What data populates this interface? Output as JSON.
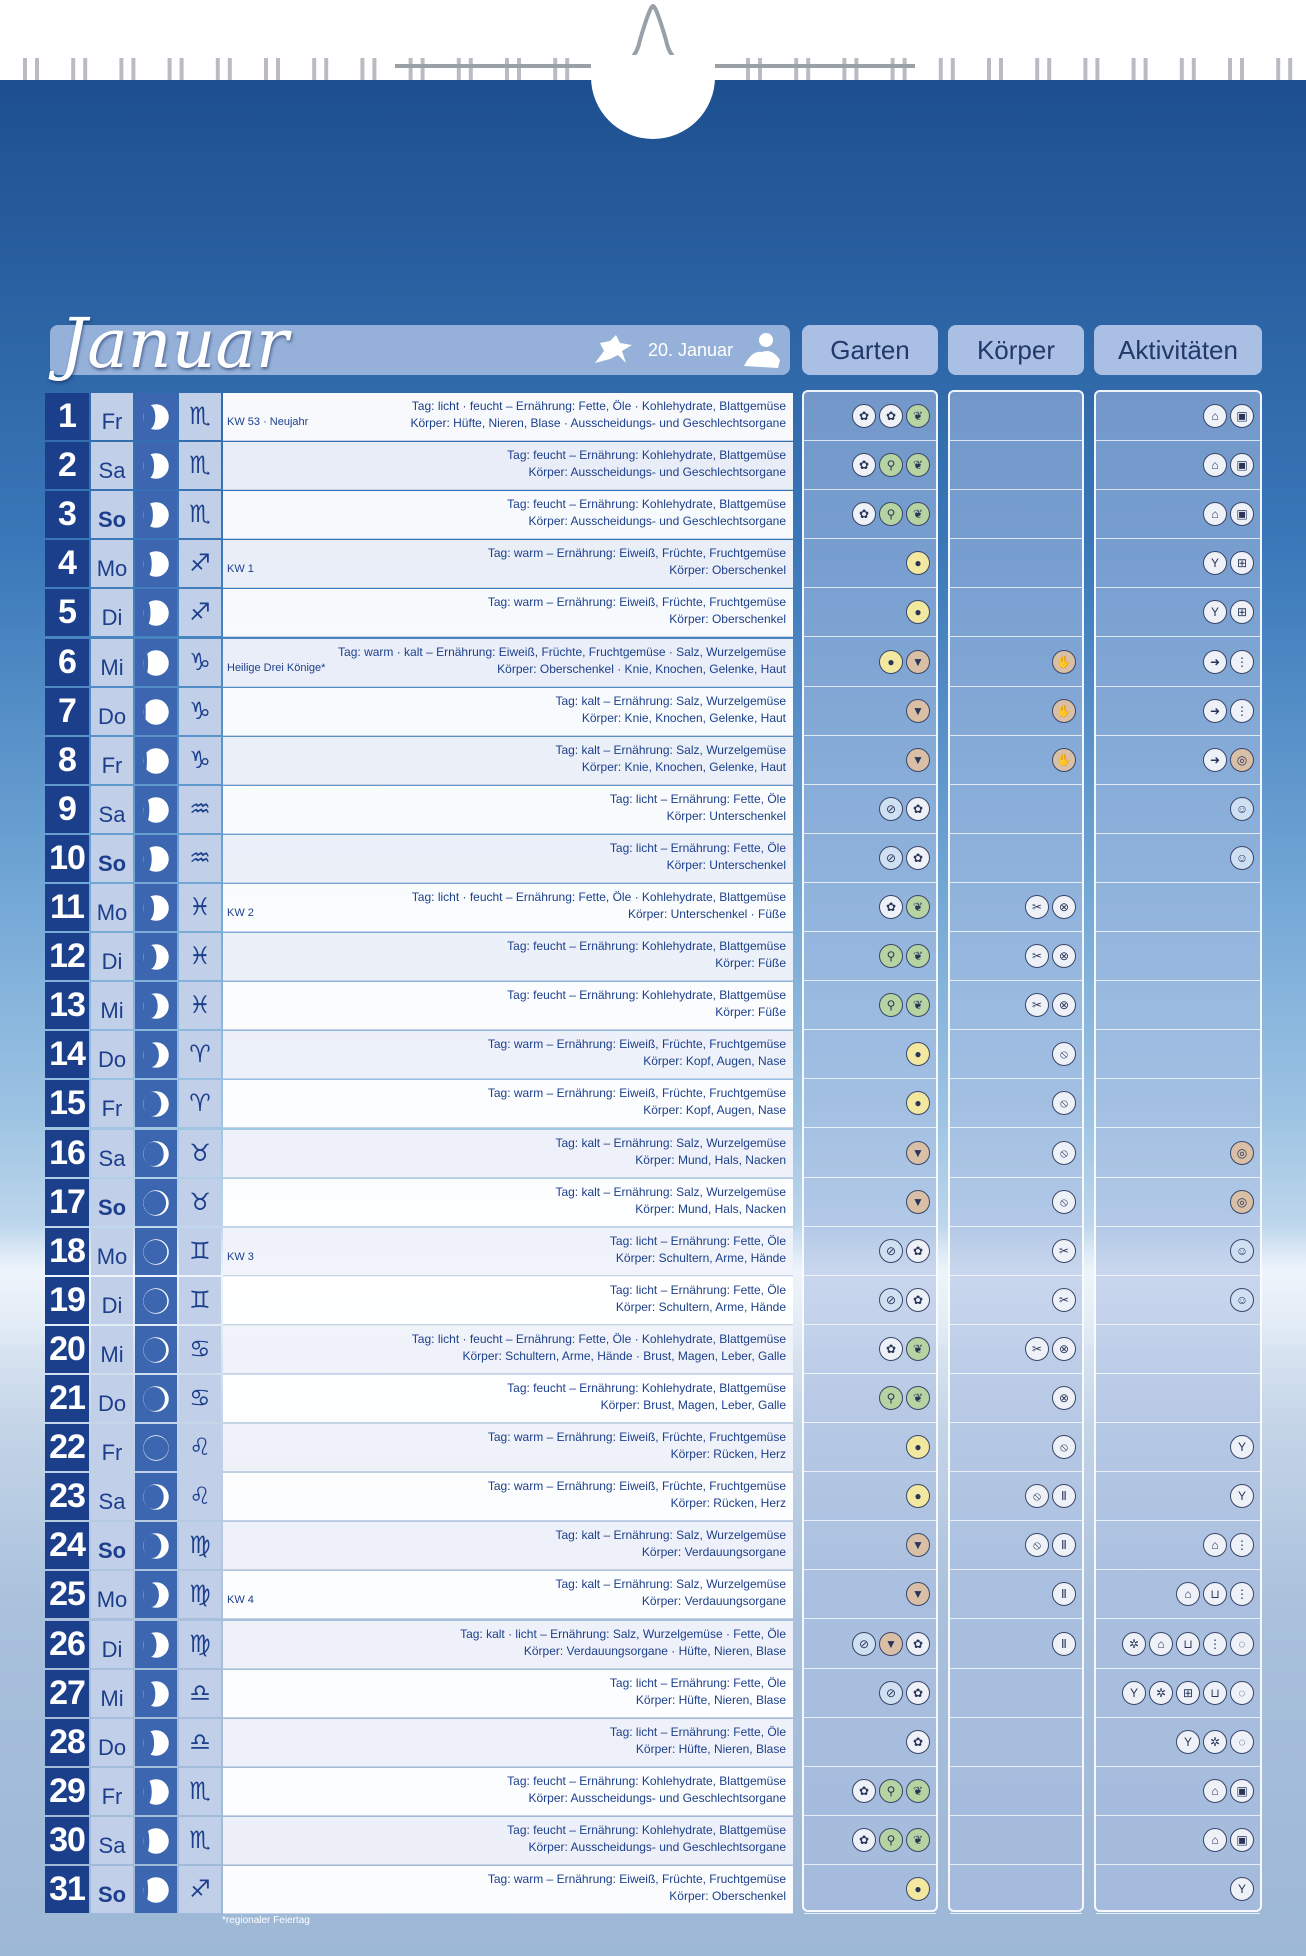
{
  "header": {
    "month": "Januar",
    "sign_change_label": "20. Januar",
    "categories": [
      "Garten",
      "Körper",
      "Aktivitäten"
    ]
  },
  "days": [
    {
      "num": "1",
      "wd": "Fr",
      "note": "KW 53 · Neujahr",
      "l1": "Tag: licht · feucht – Ernährung: Fette, Öle · Kohlehydrate, Blattgemüse",
      "l2": "Körper: Hüfte, Nieren, Blase · Ausscheidungs- und Geschlechtsorgane",
      "g": [
        "flower-icon",
        "flower-icon",
        "leaf-icon"
      ],
      "k": [],
      "a": [
        "cleaning-icon",
        "jar-icon"
      ]
    },
    {
      "num": "2",
      "wd": "Sa",
      "note": "",
      "l1": "Tag: feucht – Ernährung: Kohlehydrate, Blattgemüse",
      "l2": "Körper: Ausscheidungs- und Geschlechtsorgane",
      "g": [
        "flower-icon",
        "watering-icon",
        "leaf-icon"
      ],
      "k": [],
      "a": [
        "cleaning-icon",
        "jar-icon"
      ]
    },
    {
      "num": "3",
      "wd": "So",
      "note": "",
      "l1": "Tag: feucht – Ernährung: Kohlehydrate, Blattgemüse",
      "l2": "Körper: Ausscheidungs- und Geschlechtsorgane",
      "g": [
        "flower-icon",
        "watering-icon",
        "leaf-icon"
      ],
      "k": [],
      "a": [
        "cleaning-icon",
        "jar-icon"
      ]
    },
    {
      "num": "4",
      "wd": "Mo",
      "note": "KW 1",
      "l1": "Tag: warm – Ernährung: Eiweiß, Früchte, Fruchtgemüse",
      "l2": "Körper: Oberschenkel",
      "g": [
        "fruit-icon"
      ],
      "k": [],
      "a": [
        "glass-icon",
        "window-icon"
      ]
    },
    {
      "num": "5",
      "wd": "Di",
      "note": "",
      "l1": "Tag: warm – Ernährung: Eiweiß, Früchte, Fruchtgemüse",
      "l2": "Körper: Oberschenkel",
      "g": [
        "fruit-icon"
      ],
      "k": [],
      "a": [
        "glass-icon",
        "window-icon"
      ]
    },
    {
      "num": "6",
      "wd": "Mi",
      "note": "Heilige Drei Könige*",
      "l1": "Tag: warm · kalt – Ernährung: Eiweiß, Früchte, Fruchtgemüse · Salz, Wurzelgemüse",
      "l2": "Körper: Oberschenkel · Knie, Knochen, Gelenke, Haut",
      "g": [
        "fruit-icon",
        "root-icon"
      ],
      "k": [
        "hand-icon"
      ],
      "a": [
        "arrow-icon",
        "bottles-icon"
      ]
    },
    {
      "num": "7",
      "wd": "Do",
      "note": "",
      "l1": "Tag: kalt – Ernährung: Salz, Wurzelgemüse",
      "l2": "Körper: Knie, Knochen, Gelenke, Haut",
      "g": [
        "root-icon"
      ],
      "k": [
        "hand-icon"
      ],
      "a": [
        "arrow-icon",
        "bottles-icon"
      ]
    },
    {
      "num": "8",
      "wd": "Fr",
      "note": "",
      "l1": "Tag: kalt – Ernährung: Salz, Wurzelgemüse",
      "l2": "Körper: Knie, Knochen, Gelenke, Haut",
      "g": [
        "root-icon"
      ],
      "k": [
        "hand-icon"
      ],
      "a": [
        "arrow-icon",
        "coin-icon"
      ]
    },
    {
      "num": "9",
      "wd": "Sa",
      "note": "",
      "l1": "Tag: licht – Ernährung: Fette, Öle",
      "l2": "Körper: Unterschenkel",
      "g": [
        "no-spray-icon",
        "flower-icon"
      ],
      "k": [],
      "a": [
        "hair-icon"
      ]
    },
    {
      "num": "10",
      "wd": "So",
      "note": "",
      "l1": "Tag: licht – Ernährung: Fette, Öle",
      "l2": "Körper: Unterschenkel",
      "g": [
        "no-spray-icon",
        "flower-icon"
      ],
      "k": [],
      "a": [
        "hair-icon"
      ]
    },
    {
      "num": "11",
      "wd": "Mo",
      "note": "KW 2",
      "l1": "Tag: licht · feucht – Ernährung: Fette, Öle · Kohlehydrate, Blattgemüse",
      "l2": "Körper: Unterschenkel · Füße",
      "g": [
        "flower-icon",
        "leaf-icon"
      ],
      "k": [
        "no-cut-icon",
        "no-needle-icon"
      ],
      "a": []
    },
    {
      "num": "12",
      "wd": "Di",
      "note": "",
      "l1": "Tag: feucht – Ernährung: Kohlehydrate, Blattgemüse",
      "l2": "Körper: Füße",
      "g": [
        "watering-icon",
        "leaf-icon"
      ],
      "k": [
        "no-cut-icon",
        "no-needle-icon"
      ],
      "a": []
    },
    {
      "num": "13",
      "wd": "Mi",
      "note": "",
      "l1": "Tag: feucht – Ernährung: Kohlehydrate, Blattgemüse",
      "l2": "Körper: Füße",
      "g": [
        "watering-icon",
        "leaf-icon"
      ],
      "k": [
        "no-cut-icon",
        "no-needle-icon"
      ],
      "a": []
    },
    {
      "num": "14",
      "wd": "Do",
      "note": "",
      "l1": "Tag: warm – Ernährung: Eiweiß, Früchte, Fruchtgemüse",
      "l2": "Körper: Kopf, Augen, Nase",
      "g": [
        "fruit-icon"
      ],
      "k": [
        "no-treat-icon"
      ],
      "a": []
    },
    {
      "num": "15",
      "wd": "Fr",
      "note": "",
      "l1": "Tag: warm – Ernährung: Eiweiß, Früchte, Fruchtgemüse",
      "l2": "Körper: Kopf, Augen, Nase",
      "g": [
        "fruit-icon"
      ],
      "k": [
        "no-treat-icon"
      ],
      "a": []
    },
    {
      "num": "16",
      "wd": "Sa",
      "note": "",
      "l1": "Tag: kalt – Ernährung: Salz, Wurzelgemüse",
      "l2": "Körper: Mund, Hals, Nacken",
      "g": [
        "root-icon"
      ],
      "k": [
        "no-treat-icon"
      ],
      "a": [
        "coin-icon"
      ]
    },
    {
      "num": "17",
      "wd": "So",
      "note": "",
      "l1": "Tag: kalt – Ernährung: Salz, Wurzelgemüse",
      "l2": "Körper: Mund, Hals, Nacken",
      "g": [
        "root-icon"
      ],
      "k": [
        "no-treat-icon"
      ],
      "a": [
        "coin-icon"
      ]
    },
    {
      "num": "18",
      "wd": "Mo",
      "note": "KW 3",
      "l1": "Tag: licht – Ernährung: Fette, Öle",
      "l2": "Körper: Schultern, Arme, Hände",
      "g": [
        "no-spray-icon",
        "flower-icon"
      ],
      "k": [
        "no-cut-icon"
      ],
      "a": [
        "hair-icon"
      ]
    },
    {
      "num": "19",
      "wd": "Di",
      "note": "",
      "l1": "Tag: licht – Ernährung: Fette, Öle",
      "l2": "Körper: Schultern, Arme, Hände",
      "g": [
        "no-spray-icon",
        "flower-icon"
      ],
      "k": [
        "no-cut-icon"
      ],
      "a": [
        "hair-icon"
      ]
    },
    {
      "num": "20",
      "wd": "Mi",
      "note": "",
      "l1": "Tag: licht · feucht – Ernährung: Fette, Öle · Kohlehydrate, Blattgemüse",
      "l2": "Körper: Schultern, Arme, Hände · Brust, Magen, Leber, Galle",
      "g": [
        "flower-icon",
        "leaf-icon"
      ],
      "k": [
        "no-cut-icon",
        "no-needle-icon"
      ],
      "a": []
    },
    {
      "num": "21",
      "wd": "Do",
      "note": "",
      "l1": "Tag: feucht – Ernährung: Kohlehydrate, Blattgemüse",
      "l2": "Körper: Brust, Magen, Leber, Galle",
      "g": [
        "watering-icon",
        "leaf-icon"
      ],
      "k": [
        "no-needle-icon"
      ],
      "a": []
    },
    {
      "num": "22",
      "wd": "Fr",
      "note": "",
      "l1": "Tag: warm – Ernährung: Eiweiß, Früchte, Fruchtgemüse",
      "l2": "Körper: Rücken, Herz",
      "g": [
        "fruit-icon"
      ],
      "k": [
        "no-treat-icon"
      ],
      "a": [
        "glass-icon"
      ]
    },
    {
      "num": "23",
      "wd": "Sa",
      "note": "",
      "l1": "Tag: warm – Ernährung: Eiweiß, Früchte, Fruchtgemüse",
      "l2": "Körper: Rücken, Herz",
      "g": [
        "fruit-icon"
      ],
      "k": [
        "no-treat-icon",
        "thermo-icon"
      ],
      "a": [
        "glass-icon"
      ]
    },
    {
      "num": "24",
      "wd": "So",
      "note": "",
      "l1": "Tag: kalt – Ernährung: Salz, Wurzelgemüse",
      "l2": "Körper: Verdauungsorgane",
      "g": [
        "root-icon"
      ],
      "k": [
        "no-treat-icon",
        "thermo-icon"
      ],
      "a": [
        "cleaning-icon",
        "bottles-icon"
      ]
    },
    {
      "num": "25",
      "wd": "Mo",
      "note": "KW 4",
      "l1": "Tag: kalt – Ernährung: Salz, Wurzelgemüse",
      "l2": "Körper: Verdauungsorgane",
      "g": [
        "root-icon"
      ],
      "k": [
        "thermo-icon"
      ],
      "a": [
        "cleaning-icon",
        "bucket-icon",
        "bottles-icon"
      ]
    },
    {
      "num": "26",
      "wd": "Di",
      "note": "",
      "l1": "Tag: kalt · licht – Ernährung: Salz, Wurzelgemüse · Fette, Öle",
      "l2": "Körper: Verdauungsorgane · Hüfte, Nieren, Blase",
      "g": [
        "no-spray-icon",
        "root-icon",
        "flower-icon"
      ],
      "k": [
        "thermo-icon"
      ],
      "a": [
        "wash-icon",
        "cleaning-icon",
        "bucket-icon",
        "bottles-icon",
        "drop-icon"
      ]
    },
    {
      "num": "27",
      "wd": "Mi",
      "note": "",
      "l1": "Tag: licht – Ernährung: Fette, Öle",
      "l2": "Körper: Hüfte, Nieren, Blase",
      "g": [
        "no-spray-icon",
        "flower-icon"
      ],
      "k": [],
      "a": [
        "glass-icon",
        "wash-icon",
        "window-icon",
        "bucket-icon",
        "drop-icon"
      ]
    },
    {
      "num": "28",
      "wd": "Do",
      "note": "",
      "l1": "Tag: licht – Ernährung: Fette, Öle",
      "l2": "Körper: Hüfte, Nieren, Blase",
      "g": [
        "flower-icon"
      ],
      "k": [],
      "a": [
        "glass-icon",
        "wash-icon",
        "drop-icon"
      ]
    },
    {
      "num": "29",
      "wd": "Fr",
      "note": "",
      "l1": "Tag: feucht – Ernährung: Kohlehydrate, Blattgemüse",
      "l2": "Körper: Ausscheidungs- und Geschlechtsorgane",
      "g": [
        "flower-icon",
        "watering-icon",
        "leaf-icon"
      ],
      "k": [],
      "a": [
        "cleaning-icon",
        "jar-icon"
      ]
    },
    {
      "num": "30",
      "wd": "Sa",
      "note": "",
      "l1": "Tag: feucht – Ernährung: Kohlehydrate, Blattgemüse",
      "l2": "Körper: Ausscheidungs- und Geschlechtsorgane",
      "g": [
        "flower-icon",
        "watering-icon",
        "leaf-icon"
      ],
      "k": [],
      "a": [
        "cleaning-icon",
        "jar-icon"
      ]
    },
    {
      "num": "31",
      "wd": "So",
      "note": "",
      "l1": "Tag: warm – Ernährung: Eiweiß, Früchte, Fruchtgemüse",
      "l2": "Körper: Oberschenkel",
      "g": [
        "fruit-icon"
      ],
      "k": [],
      "a": [
        "glass-icon"
      ]
    }
  ],
  "footnote": "*regionaler Feiertag"
}
